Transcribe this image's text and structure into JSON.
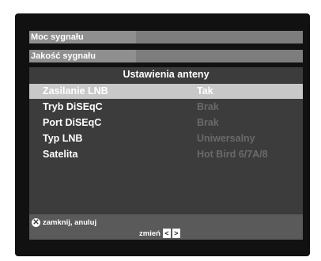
{
  "signal": {
    "strength_label": "Moc sygnału",
    "strength_level": 0.39,
    "quality_label": "Jakość sygnału",
    "quality_level": 0.39
  },
  "menu": {
    "title": "Ustawienia anteny",
    "items": [
      {
        "label": "Zasilanie LNB",
        "value": "Tak"
      },
      {
        "label": "Tryb DiSEqC",
        "value": "Brak"
      },
      {
        "label": "Port DiSEqC",
        "value": "Brak"
      },
      {
        "label": "Typ LNB",
        "value": "Uniwersalny"
      },
      {
        "label": "Satelita",
        "value": "Hot Bird 6/7A/8"
      }
    ]
  },
  "footer": {
    "close_hint": "zamknij, anuluj",
    "change_hint": "zmień",
    "close_icon": "circle-x-icon",
    "left_icon": "chevron-left-icon",
    "right_icon": "chevron-right-icon"
  },
  "colors": {
    "selected_row_bg": "#c8c8c8",
    "dim_value": "#6a6a6a"
  }
}
